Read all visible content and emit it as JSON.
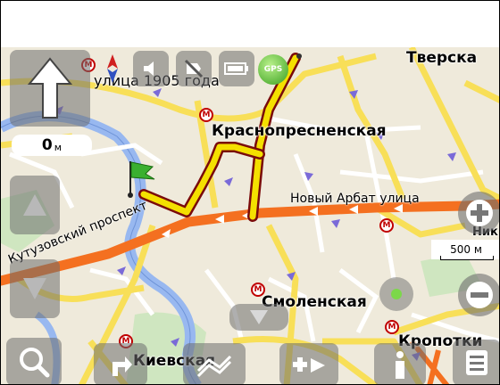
{
  "map": {
    "places": {
      "tverskaya": "Тверска",
      "krasnopresnenskaya": "Краснопресненская",
      "smolenskaya": "Смоленская",
      "kievskaya": "Киевская",
      "kropotkinskaya": "Кропотки",
      "street_1905": "улица 1905 года",
      "novy_arbat": "Новый Арбат улица",
      "kutuzovsky": "Кутузовский проспект",
      "nik": "Ник"
    },
    "metro_symbol": "M"
  },
  "route": {
    "distance_value": "0",
    "distance_unit": "м"
  },
  "scale": {
    "label": "500 м"
  },
  "gps": {
    "label": "GPS"
  },
  "icons": {
    "turn_arrow": "arrow-up-icon",
    "compass": "compass-icon",
    "sound": "speaker-icon",
    "mute": "mute-icon",
    "battery": "battery-icon",
    "zoom_in": "plus-icon",
    "zoom_out": "minus-icon",
    "search": "magnifier-icon",
    "menu": "list-icon",
    "info": "info-icon",
    "finish": "green-flag-icon"
  },
  "colors": {
    "route": "#f4e000",
    "route_outline": "#7a0a0a",
    "main_road": "#f47020",
    "road": "#f8df58",
    "river": "#98b8f0",
    "background": "#efeadb"
  }
}
